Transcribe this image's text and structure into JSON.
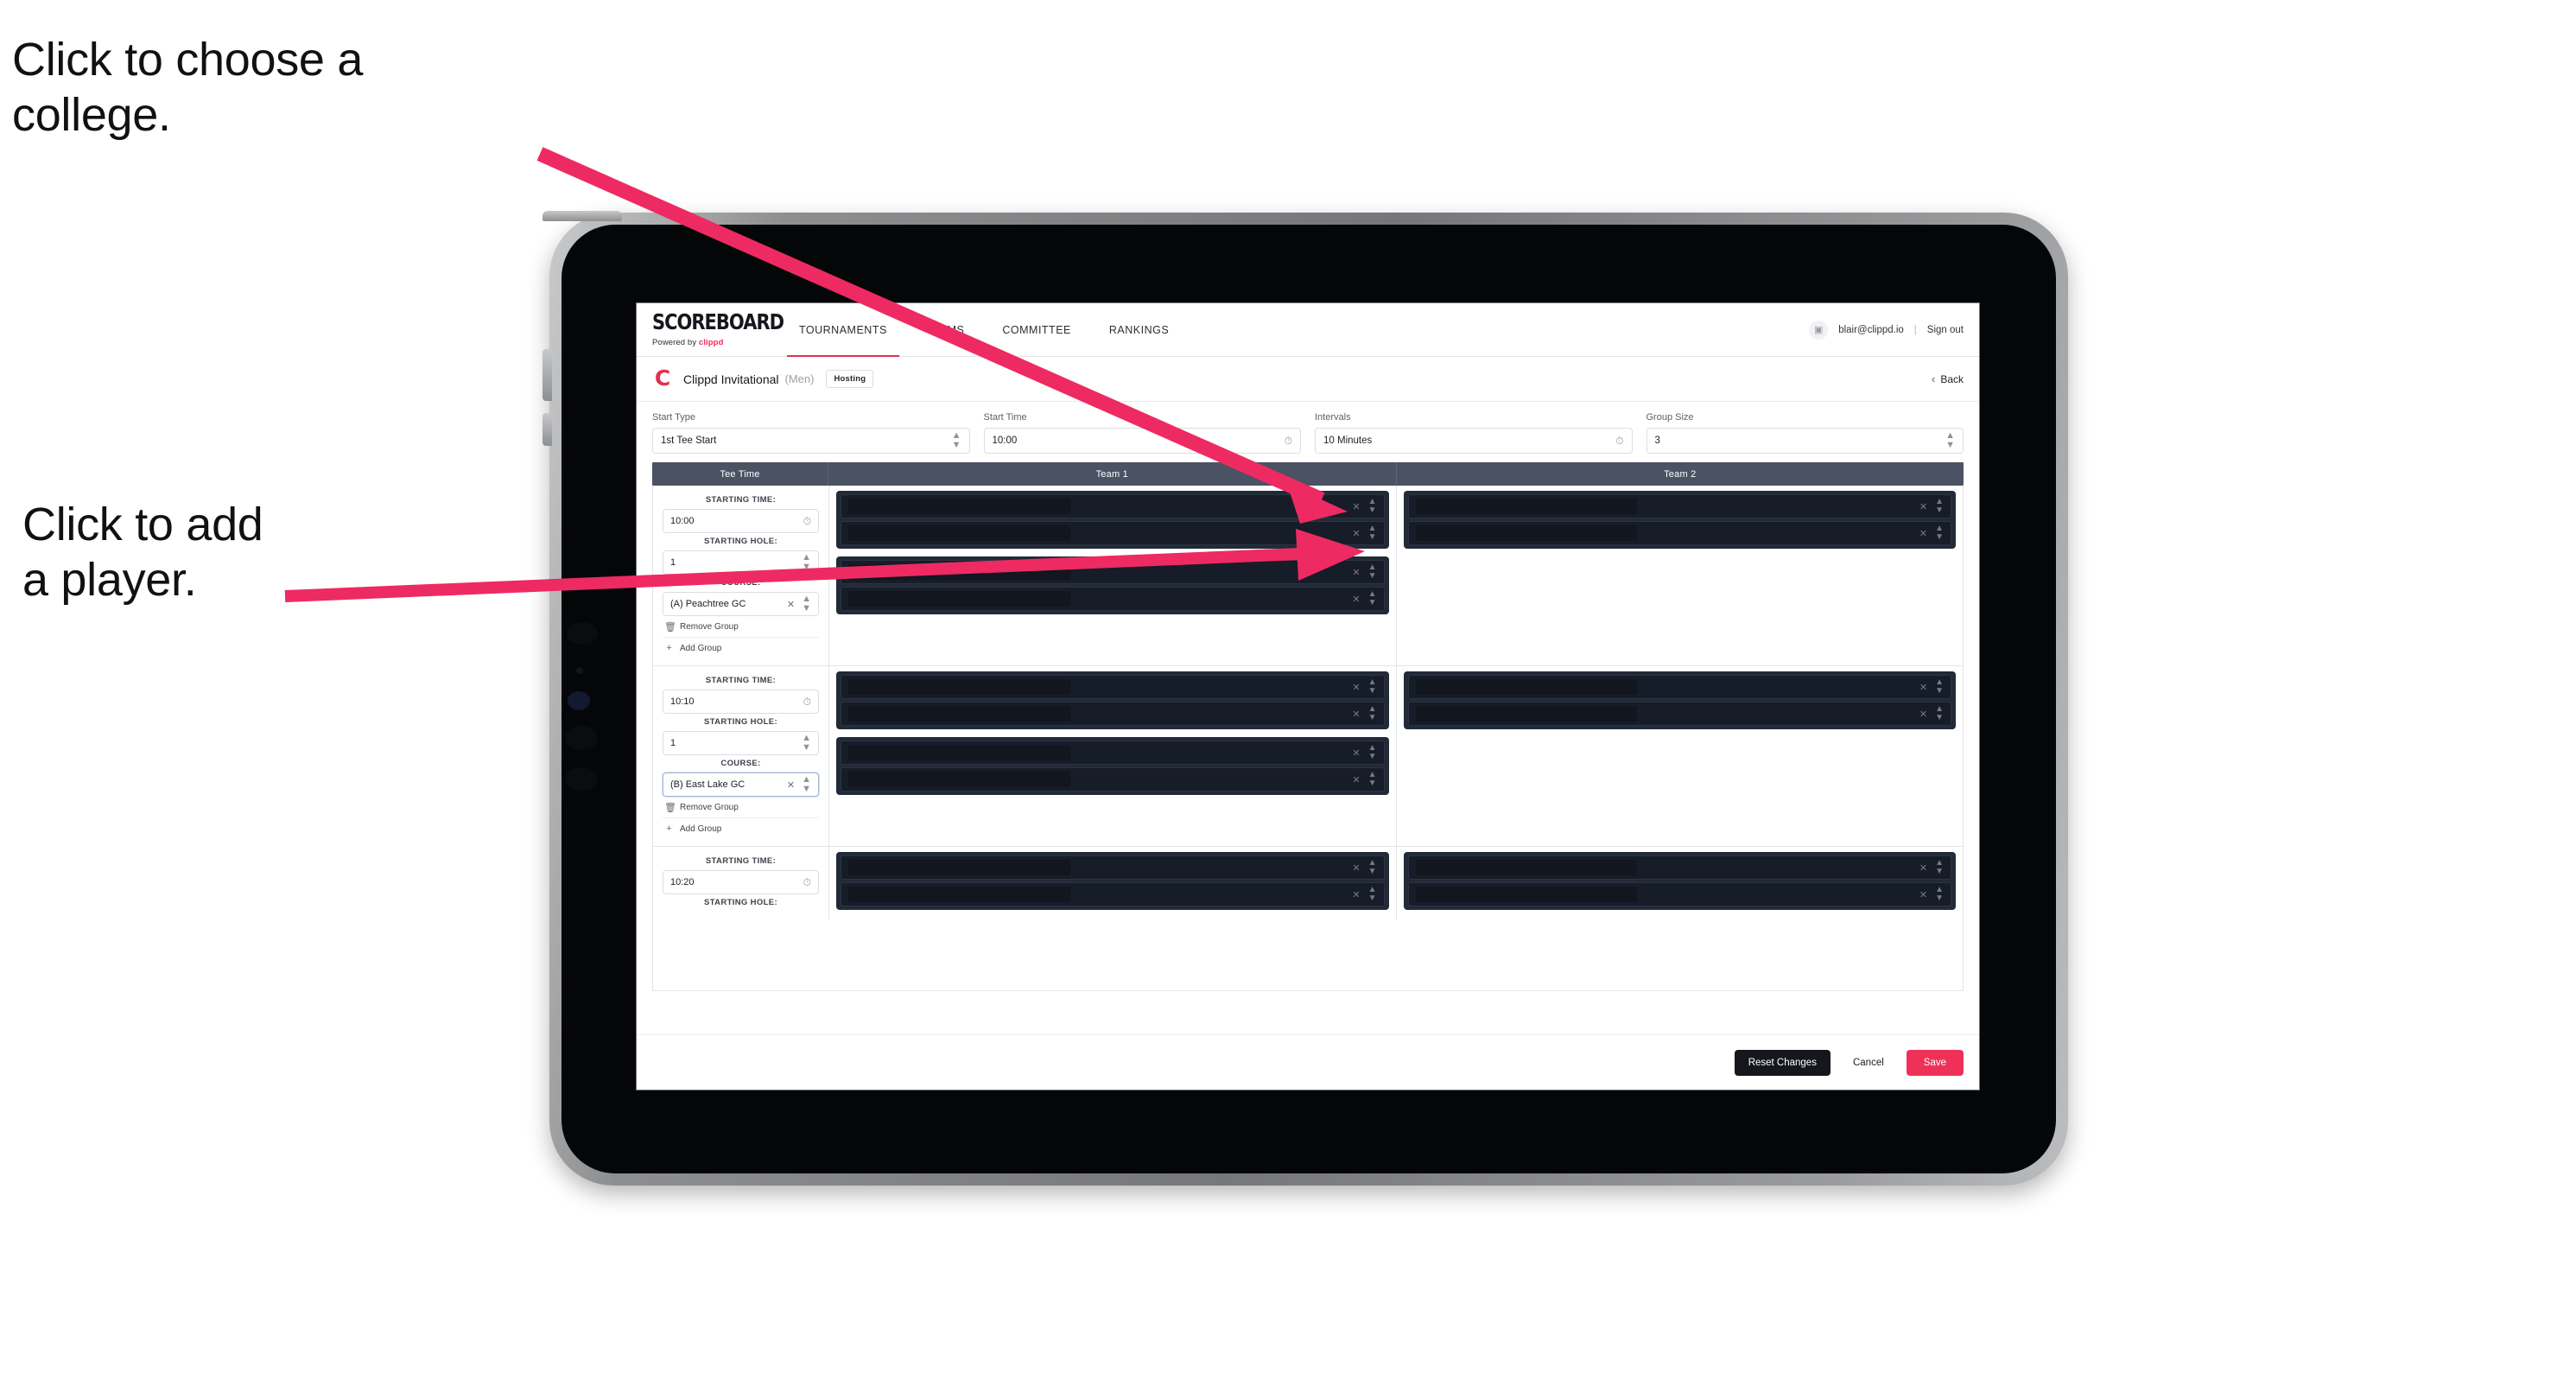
{
  "annotations": {
    "college": "Click to choose a\ncollege.",
    "player": "Click to add\na player.",
    "arrow_color": "#ee2a62"
  },
  "topnav": {
    "brand_word": "SCOREBOARD",
    "brand_sub_prefix": "Powered by ",
    "brand_sub_accent": "clippd",
    "links": [
      {
        "label": "TOURNAMENTS",
        "active": true
      },
      {
        "label": "TEAMS",
        "active": false
      },
      {
        "label": "COMMITTEE",
        "active": false
      },
      {
        "label": "RANKINGS",
        "active": false
      }
    ],
    "avatar_icon": "user-avatar-icon",
    "user_email": "blair@clippd.io",
    "divider": "|",
    "sign_out": "Sign out",
    "accent": "#e0304f"
  },
  "subheader": {
    "logo_glyph": "C",
    "tournament_name": "Clippd Invitational",
    "gender": "(Men)",
    "badge": "Hosting",
    "back_chevron": "‹",
    "back_label": "Back"
  },
  "controls": [
    {
      "label": "Start Type",
      "value": "1st Tee Start",
      "icon": "stepper-icon"
    },
    {
      "label": "Start Time",
      "value": "10:00",
      "icon": "clock-icon"
    },
    {
      "label": "Intervals",
      "value": "10 Minutes",
      "icon": "clock-icon"
    },
    {
      "label": "Group Size",
      "value": "3",
      "icon": "stepper-icon"
    }
  ],
  "table": {
    "headers": {
      "tee_time": "Tee Time",
      "team1": "Team 1",
      "team2": "Team 2"
    },
    "field_labels": {
      "starting_time": "STARTING TIME:",
      "starting_hole": "STARTING HOLE:",
      "course": "COURSE:"
    },
    "actions": {
      "remove_group": "Remove Group",
      "add_group": "Add Group"
    },
    "groups": [
      {
        "starting_time": "10:00",
        "starting_hole": "1",
        "course": "(A) Peachtree GC",
        "course_focused": false,
        "team1_groups": [
          2,
          2
        ],
        "team2_groups": [
          2
        ]
      },
      {
        "starting_time": "10:10",
        "starting_hole": "1",
        "course": "(B) East Lake GC",
        "course_focused": true,
        "team1_groups": [
          2,
          2
        ],
        "team2_groups": [
          2
        ]
      },
      {
        "starting_time": "10:20",
        "starting_hole": "",
        "course": "",
        "course_focused": false,
        "team1_groups": [
          2
        ],
        "team2_groups": [
          2
        ]
      }
    ]
  },
  "footer": {
    "reset": "Reset Changes",
    "cancel": "Cancel",
    "save": "Save",
    "save_color": "#ef3158"
  }
}
